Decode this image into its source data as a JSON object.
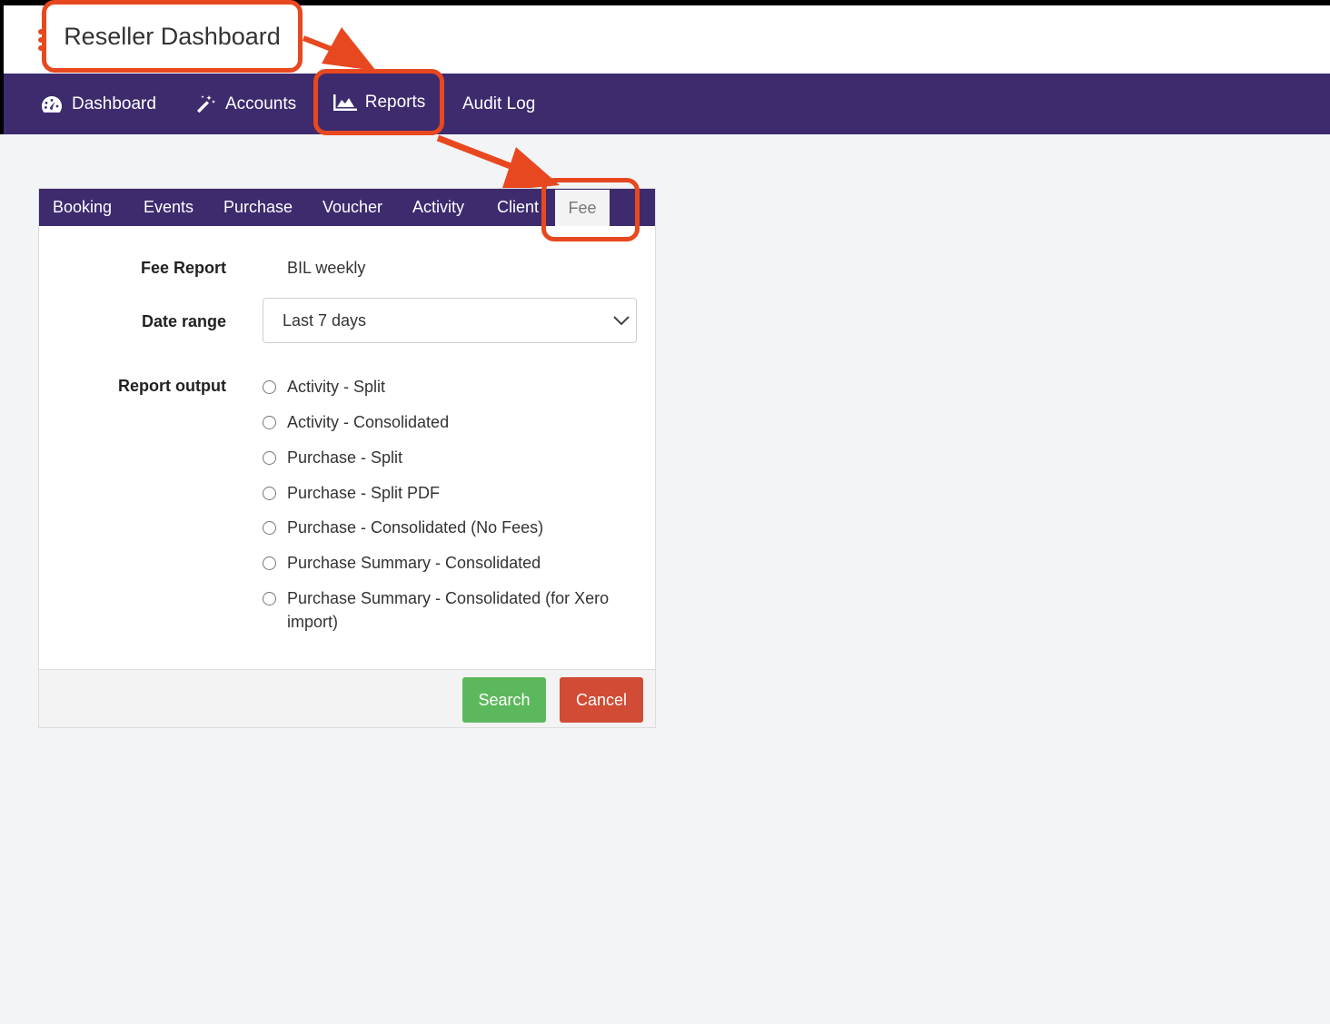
{
  "header": {
    "title": "Reseller Dashboard"
  },
  "topnav": {
    "items": [
      {
        "label": "Dashboard",
        "icon": "tachometer-icon"
      },
      {
        "label": "Accounts",
        "icon": "magic-wand-icon"
      },
      {
        "label": "Reports",
        "icon": "area-chart-icon"
      },
      {
        "label": "Audit Log",
        "icon": ""
      }
    ]
  },
  "tabs": {
    "items": [
      "Booking",
      "Events",
      "Purchase",
      "Voucher",
      "Activity",
      "Client",
      "Fee"
    ],
    "active": "Fee"
  },
  "form": {
    "fee_report_label": "Fee Report",
    "fee_report_value": "BIL weekly",
    "date_range_label": "Date range",
    "date_range_value": "Last 7 days",
    "report_output_label": "Report output",
    "options": [
      "Activity - Split",
      "Activity - Consolidated",
      "Purchase - Split",
      "Purchase - Split PDF",
      "Purchase - Consolidated (No Fees)",
      "Purchase Summary - Consolidated",
      "Purchase Summary - Consolidated (for Xero import)"
    ]
  },
  "buttons": {
    "search": "Search",
    "cancel": "Cancel"
  },
  "colors": {
    "nav_bg": "#3d2b6e",
    "highlight": "#e8481f",
    "search_btn": "#5cb85c",
    "cancel_btn": "#d14b35"
  }
}
